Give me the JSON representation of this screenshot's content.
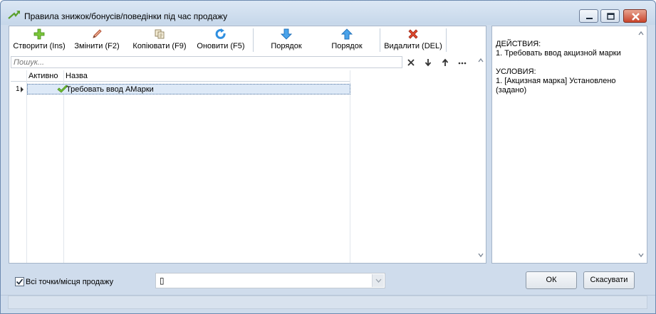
{
  "window": {
    "title": "Правила знижок/бонусів/поведінки під час продажу"
  },
  "toolbar": {
    "create": {
      "label": "Створити (Ins)",
      "icon": "plus-icon"
    },
    "edit": {
      "label": "Змінити (F2)",
      "icon": "pencil-icon"
    },
    "copy": {
      "label": "Копіювати (F9)",
      "icon": "copy-icon"
    },
    "refresh": {
      "label": "Оновити (F5)",
      "icon": "refresh-icon"
    },
    "order_down": {
      "label": "Порядок",
      "icon": "arrow-down-icon"
    },
    "order_up": {
      "label": "Порядок",
      "icon": "arrow-up-icon"
    },
    "delete": {
      "label": "Видалити (DEL)",
      "icon": "delete-x-icon"
    }
  },
  "search": {
    "placeholder": "Пошук..."
  },
  "grid": {
    "columns": [
      "Активно",
      "Назва"
    ],
    "rows": [
      {
        "num": "1",
        "active": true,
        "name": "Требовать ввод АМарки"
      }
    ]
  },
  "details": {
    "actions_header": "ДЕЙСТВИЯ:",
    "actions_line": "1. Требовать ввод акцизной марки",
    "conditions_header": "УСЛОВИЯ:",
    "conditions_line1": "1. [Акцизная марка] Установлено",
    "conditions_line2": "(задано)"
  },
  "bottom": {
    "all_points_label": "Всі точки/місця продажу",
    "all_points_checked": true,
    "combo_value": "▯",
    "ok_label": "ОК",
    "cancel_label": "Скасувати"
  },
  "colors": {
    "accent_green": "#4caf1e",
    "accent_blue": "#2f8fe0",
    "delete_red": "#d9371f",
    "selection": "#dde9f7"
  }
}
